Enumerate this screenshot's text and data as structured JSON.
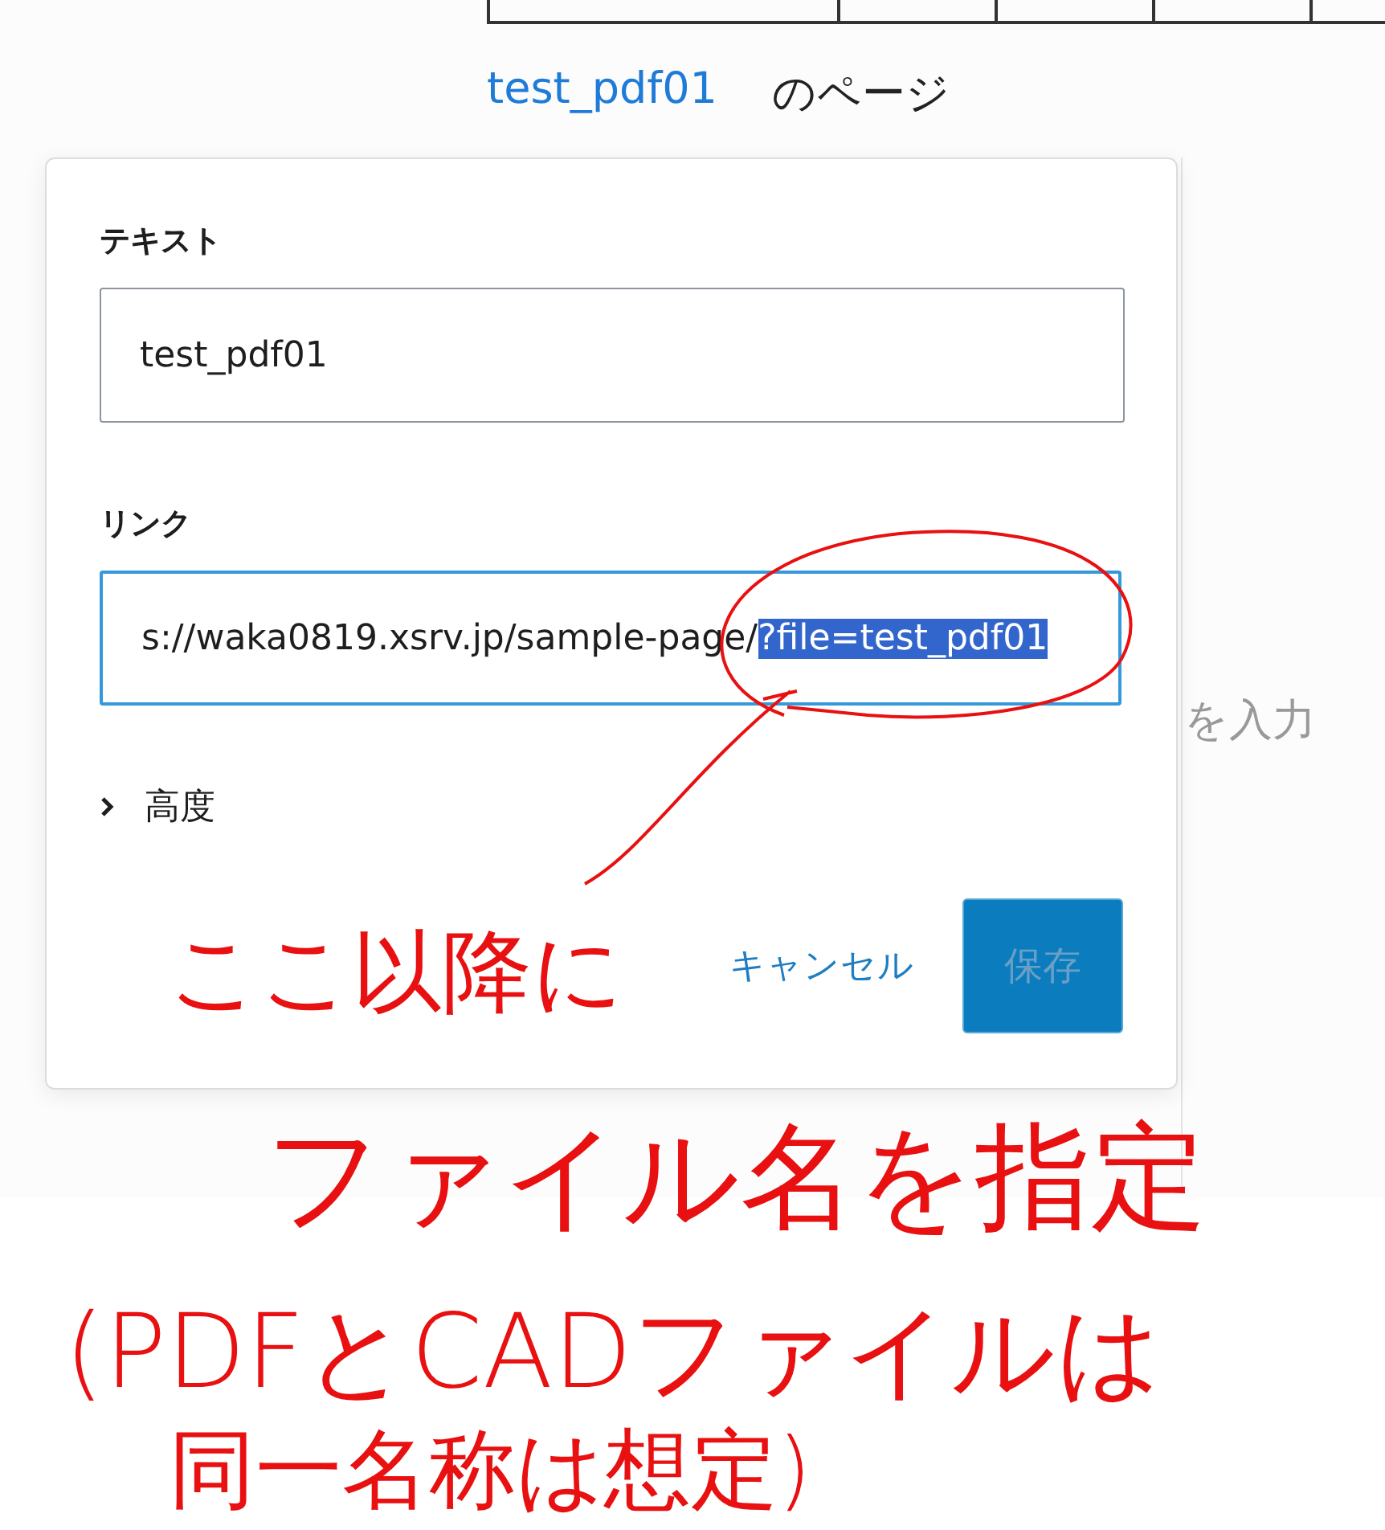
{
  "page_title": {
    "link": "test_pdf01",
    "text": "のページ"
  },
  "background_hint": "を入力",
  "link_popover": {
    "fields": [
      {
        "label": "テキスト",
        "value": "test_pdf01",
        "focused": false
      },
      {
        "label": "リンク",
        "value": "s://waka0819.xsrv.jp/sample-page/",
        "selected_text": "?file=test_pdf01",
        "focused": true
      }
    ],
    "advanced": {
      "label": "高度",
      "expanded": false
    },
    "cancel": "キャンセル",
    "save": {
      "label": "保存",
      "disabled": true
    }
  },
  "annotations": [
    "ここ以降に",
    "ファイル名を指定",
    "(PDFとCADファイルは",
    "同一名称は想定)"
  ]
}
